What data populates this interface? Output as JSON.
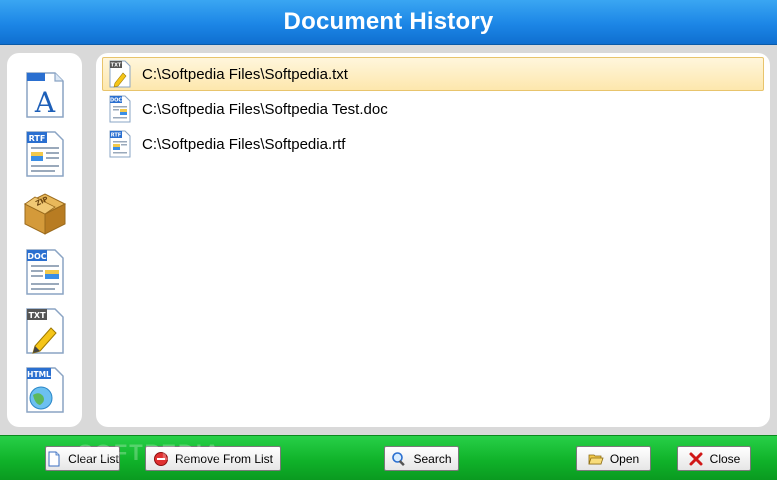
{
  "window": {
    "title": "Document History"
  },
  "sidebar": {
    "items": [
      {
        "name": "font-document-icon",
        "badge": ""
      },
      {
        "name": "rtf-document-icon",
        "badge": "RTF"
      },
      {
        "name": "zip-archive-icon",
        "badge": "ZIP"
      },
      {
        "name": "doc-document-icon",
        "badge": "DOC"
      },
      {
        "name": "txt-document-icon",
        "badge": "TXT"
      },
      {
        "name": "html-document-icon",
        "badge": "HTML"
      }
    ]
  },
  "files": [
    {
      "path": "C:\\Softpedia Files\\Softpedia.txt",
      "type": "TXT",
      "selected": true
    },
    {
      "path": "C:\\Softpedia Files\\Softpedia Test.doc",
      "type": "DOC",
      "selected": false
    },
    {
      "path": "C:\\Softpedia Files\\Softpedia.rtf",
      "type": "RTF",
      "selected": false
    }
  ],
  "toolbar": {
    "clear_list": "Clear List",
    "remove_from_list": "Remove From List",
    "search": "Search",
    "open": "Open",
    "close": "Close"
  },
  "watermark": "SOFTPEDIA",
  "colors": {
    "title_bar": "#1c86e6",
    "bottom_bar": "#10b32a",
    "selection": "#fde7ad"
  }
}
